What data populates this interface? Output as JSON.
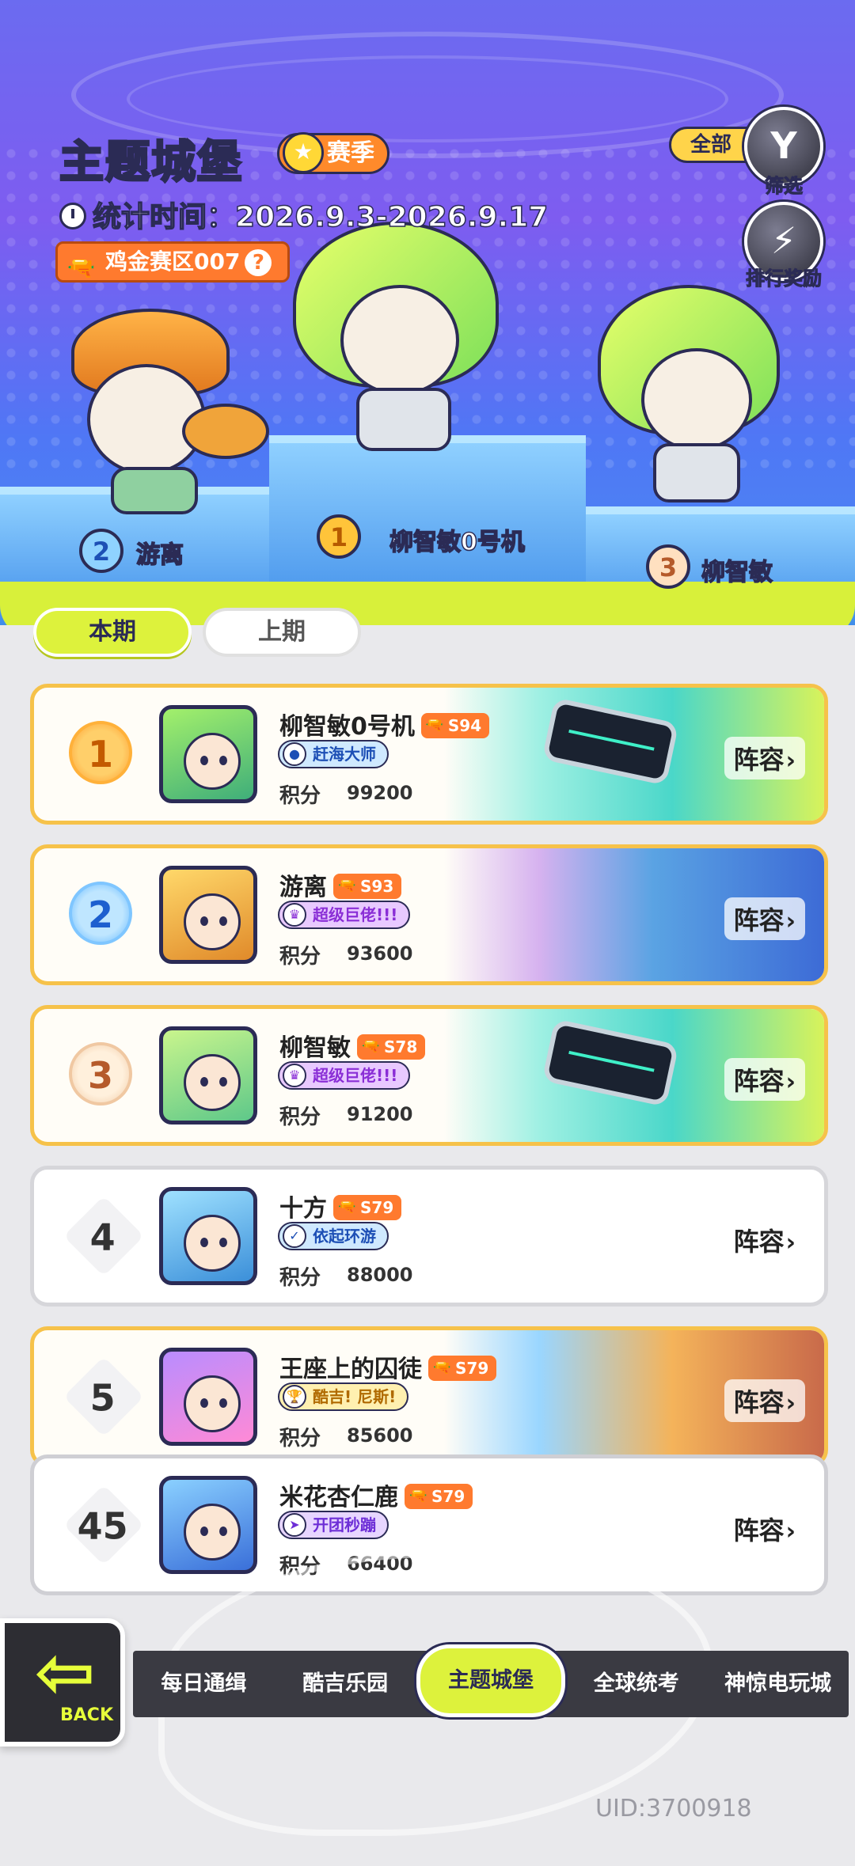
{
  "header": {
    "title": "主题城堡",
    "season_label": "赛季",
    "stat_label": "统计时间：",
    "stat_range": "2026.9.3-2026.9.17",
    "zone_label": "鸡金赛区007",
    "zone_help": "?",
    "filter_pill": "全部",
    "filter_label": "筛选",
    "reward_label": "排行奖励"
  },
  "podium": [
    {
      "rank": "1",
      "name": "柳智敏0号机"
    },
    {
      "rank": "2",
      "name": "游离"
    },
    {
      "rank": "3",
      "name": "柳智敏"
    }
  ],
  "tabs": {
    "current": "本期",
    "previous": "上期"
  },
  "ranking": [
    {
      "rank": "1",
      "name": "柳智敏0号机",
      "season": "S94",
      "badge": "赶海大师",
      "score_label": "积分",
      "score": "99200",
      "lineup": "阵容"
    },
    {
      "rank": "2",
      "name": "游离",
      "season": "S93",
      "badge": "超级巨佬!!!",
      "score_label": "积分",
      "score": "93600",
      "lineup": "阵容"
    },
    {
      "rank": "3",
      "name": "柳智敏",
      "season": "S78",
      "badge": "超级巨佬!!!",
      "score_label": "积分",
      "score": "91200",
      "lineup": "阵容"
    },
    {
      "rank": "4",
      "name": "十方",
      "season": "S79",
      "badge": "依起环游",
      "score_label": "积分",
      "score": "88000",
      "lineup": "阵容"
    },
    {
      "rank": "5",
      "name": "王座上的囚徒",
      "season": "S79",
      "badge": "酷吉! 尼斯!",
      "score_label": "积分",
      "score": "85600",
      "lineup": "阵容"
    },
    {
      "rank": "45",
      "name": "米花杏仁鹿",
      "season": "S79",
      "badge": "开团秒蹦",
      "score_label": "积分",
      "score": "66400",
      "lineup": "阵容"
    }
  ],
  "nav": {
    "back": "BACK",
    "items": [
      "每日通缉",
      "酷吉乐园",
      "主题城堡",
      "全球统考",
      "神惊电玩城"
    ],
    "active_index": 2
  },
  "uid": "UID:3700918",
  "colors": {
    "accent_lime": "#ddf23c",
    "orange_tag": "#ff7a2e",
    "hero_purple": "#6b6bf0",
    "dark_nav": "#3a3a42"
  }
}
